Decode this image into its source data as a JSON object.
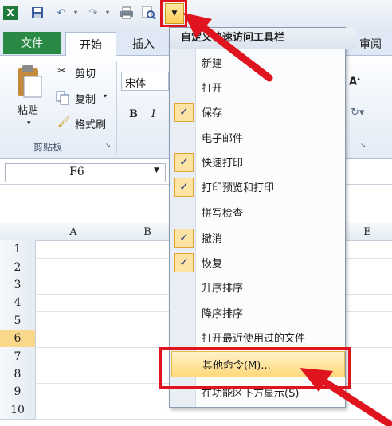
{
  "qat": {
    "items": [
      "excel-logo-icon",
      "save-icon",
      "undo-icon",
      "redo-icon",
      "print-icon",
      "print-preview-icon"
    ],
    "dropdown_glyph": "▼"
  },
  "tabs": {
    "file": "文件",
    "home": "开始",
    "insert": "插入",
    "review": "审阅"
  },
  "ribbon": {
    "paste": "粘贴",
    "cut": "剪切",
    "copy": "复制",
    "format_painter": "格式刷",
    "clipboard_group": "剪贴板",
    "font_name": "宋体",
    "bold": "B",
    "italic": "I"
  },
  "namebox": {
    "value": "F6"
  },
  "grid": {
    "columns": [
      "A",
      "B",
      "E"
    ],
    "rows": [
      "1",
      "2",
      "3",
      "4",
      "5",
      "6",
      "7",
      "8",
      "9",
      "10"
    ],
    "selected_row": "6"
  },
  "menu": {
    "title": "自定义快速访问工具栏",
    "items": [
      {
        "label": "新建",
        "checked": false
      },
      {
        "label": "打开",
        "checked": false
      },
      {
        "label": "保存",
        "checked": true
      },
      {
        "label": "电子邮件",
        "checked": false
      },
      {
        "label": "快速打印",
        "checked": true
      },
      {
        "label": "打印预览和打印",
        "checked": true
      },
      {
        "label": "拼写检查",
        "checked": false
      },
      {
        "label": "撤消",
        "checked": true
      },
      {
        "label": "恢复",
        "checked": true
      },
      {
        "label": "升序排序",
        "checked": false
      },
      {
        "label": "降序排序",
        "checked": false
      },
      {
        "label": "打开最近使用过的文件",
        "checked": false
      },
      {
        "label": "其他命令(M)...",
        "checked": false,
        "highlighted": true
      },
      {
        "label": "在功能区下方显示(S)",
        "checked": false
      }
    ],
    "check_glyph": "✓"
  },
  "colors": {
    "annotation": "#e0141e",
    "file_tab": "#2a8a45",
    "highlight": "#ffd97a"
  }
}
